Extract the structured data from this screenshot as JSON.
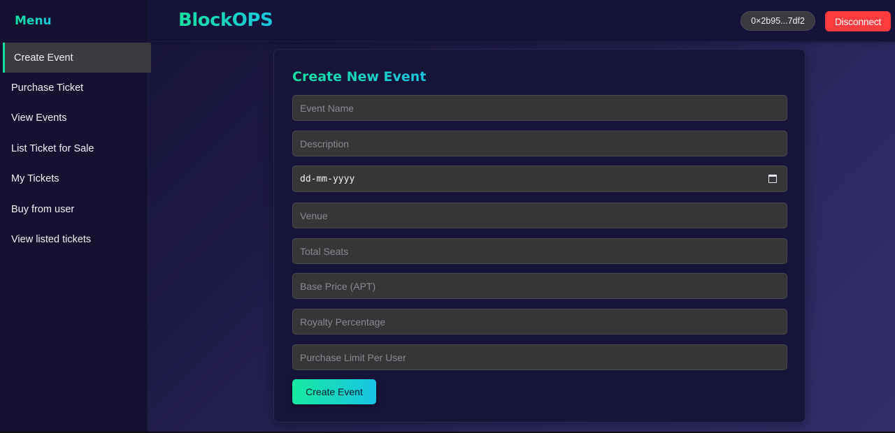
{
  "sidebar": {
    "title": "Menu",
    "items": [
      {
        "label": "Create Event",
        "active": true
      },
      {
        "label": "Purchase Ticket"
      },
      {
        "label": "View Events"
      },
      {
        "label": "List Ticket for Sale"
      },
      {
        "label": "My Tickets"
      },
      {
        "label": "Buy from user"
      },
      {
        "label": "View listed tickets"
      }
    ]
  },
  "header": {
    "brand": "BlockOPS",
    "wallet_address": "0×2b95...7df2",
    "disconnect_label": "Disconnect"
  },
  "form": {
    "title": "Create New Event",
    "fields": {
      "event_name": {
        "placeholder": "Event Name",
        "value": ""
      },
      "description": {
        "placeholder": "Description",
        "value": ""
      },
      "date": {
        "placeholder": "dd-mm-yyyy",
        "value": ""
      },
      "venue": {
        "placeholder": "Venue",
        "value": ""
      },
      "total_seats": {
        "placeholder": "Total Seats",
        "value": ""
      },
      "base_price": {
        "placeholder": "Base Price (APT)",
        "value": ""
      },
      "royalty": {
        "placeholder": "Royalty Percentage",
        "value": ""
      },
      "purchase_limit": {
        "placeholder": "Purchase Limit Per User",
        "value": ""
      }
    },
    "submit_label": "Create Event"
  },
  "colors": {
    "accent_gradient_start": "#16e0a0",
    "accent_gradient_end": "#1bc6e0",
    "danger": "#ff3b3f",
    "background": "#1d1945"
  },
  "icons": {
    "date_picker": "calendar-icon"
  }
}
